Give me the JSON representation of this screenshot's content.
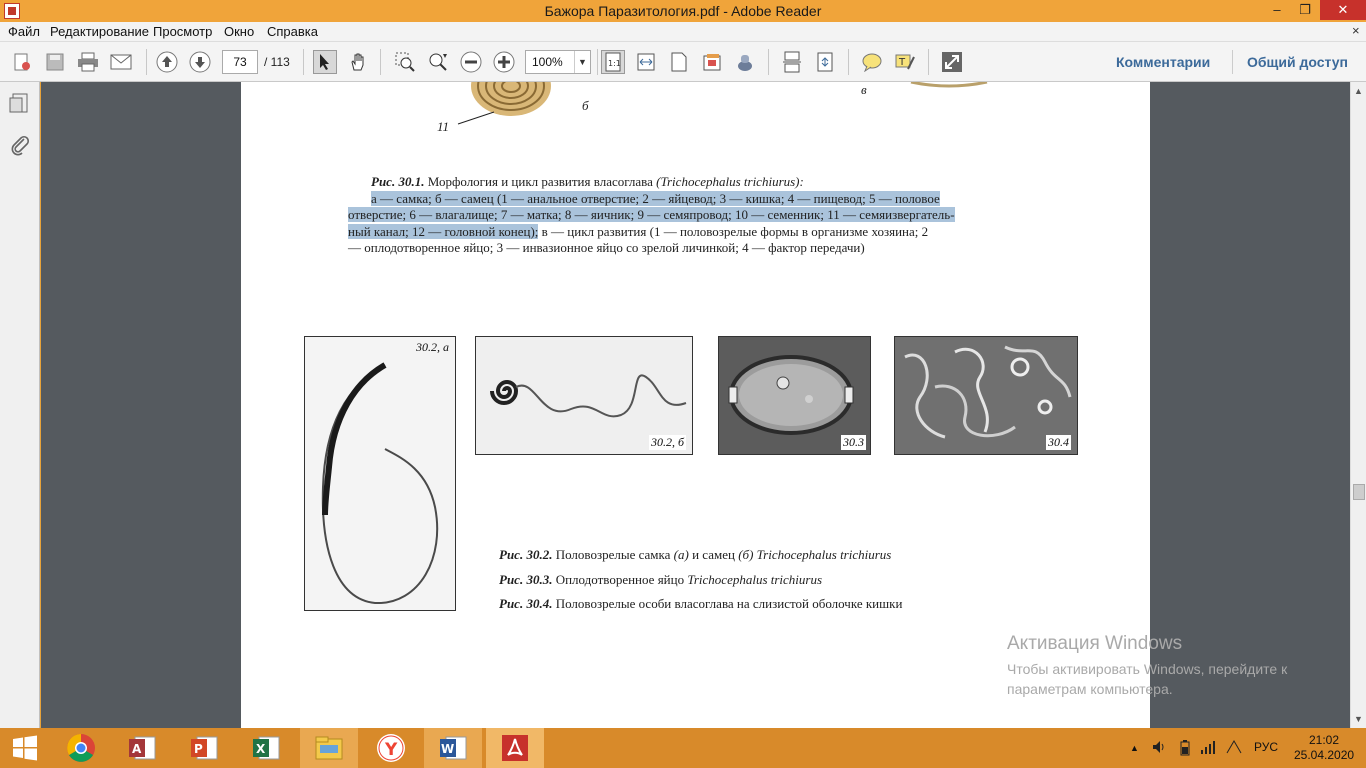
{
  "window": {
    "title": "Бажора Паразитология.pdf - Adobe Reader",
    "min_symbol": "–",
    "max_symbol": "❐",
    "close_symbol": "✕"
  },
  "menu": {
    "items": [
      "Файл",
      "Редактирование",
      "Просмотр",
      "Окно",
      "Справка"
    ],
    "close_symbol": "×"
  },
  "toolbar": {
    "page_current": "73",
    "page_total": "/ 113",
    "zoom": "100%",
    "comments_label": "Комментарии",
    "share_label": "Общий доступ"
  },
  "document": {
    "top_fragment": {
      "label_11": "11",
      "label_b": "б",
      "label_v": "в"
    },
    "fig_30_1": {
      "line1_bold": "Рис. 30.1.",
      "line1_text": " Морфология и цикл развития власоглава ",
      "line1_italic": "(Trichocephalus trichiurus):",
      "line2": "а — самка; б — самец (1 — анальное отверстие; 2 — яйцевод; 3 — кишка; 4 — пищевод; 5 — половое",
      "line3": "отверстие; 6 — влагалище; 7 — матка; 8 — яичник; 9 — семяпровод; 10 — семенник; 11 — семяизвергатель-",
      "line4_hl": "ный канал; 12 — головной конец);",
      "line4_rest": " в — цикл развития (1 — половозрелые формы в организме хозяина; 2",
      "line5": "— оплодотворенное яйцо; 3 — инвазионное яйцо со зрелой личинкой; 4 — фактор передачи)"
    },
    "figures": {
      "fig_30_2a": "30.2, а",
      "fig_30_2b": "30.2, б",
      "fig_30_3": "30.3",
      "fig_30_4": "30.4"
    },
    "captions": {
      "c1_bold": "Рис. 30.2.",
      "c1_text": " Половозрелые самка ",
      "c1_a": "(а)",
      "c1_mid": " и самец ",
      "c1_b": "(б)",
      "c1_it": " Trichocephalus trichiurus",
      "c2_bold": "Рис. 30.3.",
      "c2_text": " Оплодотворенное яйцо ",
      "c2_it": "Trichocephalus trichiurus",
      "c3_bold": "Рис. 30.4.",
      "c3_text": " Половозрелые особи власоглава на слизистой оболочке кишки"
    }
  },
  "watermark": {
    "title": "Активация Windows",
    "line1": "Чтобы активировать Windows, перейдите к",
    "line2": "параметрам компьютера."
  },
  "taskbar": {
    "tray_up": "▲",
    "lang": "РУС",
    "time": "21:02",
    "date": "25.04.2020"
  },
  "colors": {
    "accent_titlebar": "#f0a43a",
    "taskbar": "#d88a2a",
    "highlight": "#aac3db",
    "link_blue": "#3c6a9a"
  }
}
